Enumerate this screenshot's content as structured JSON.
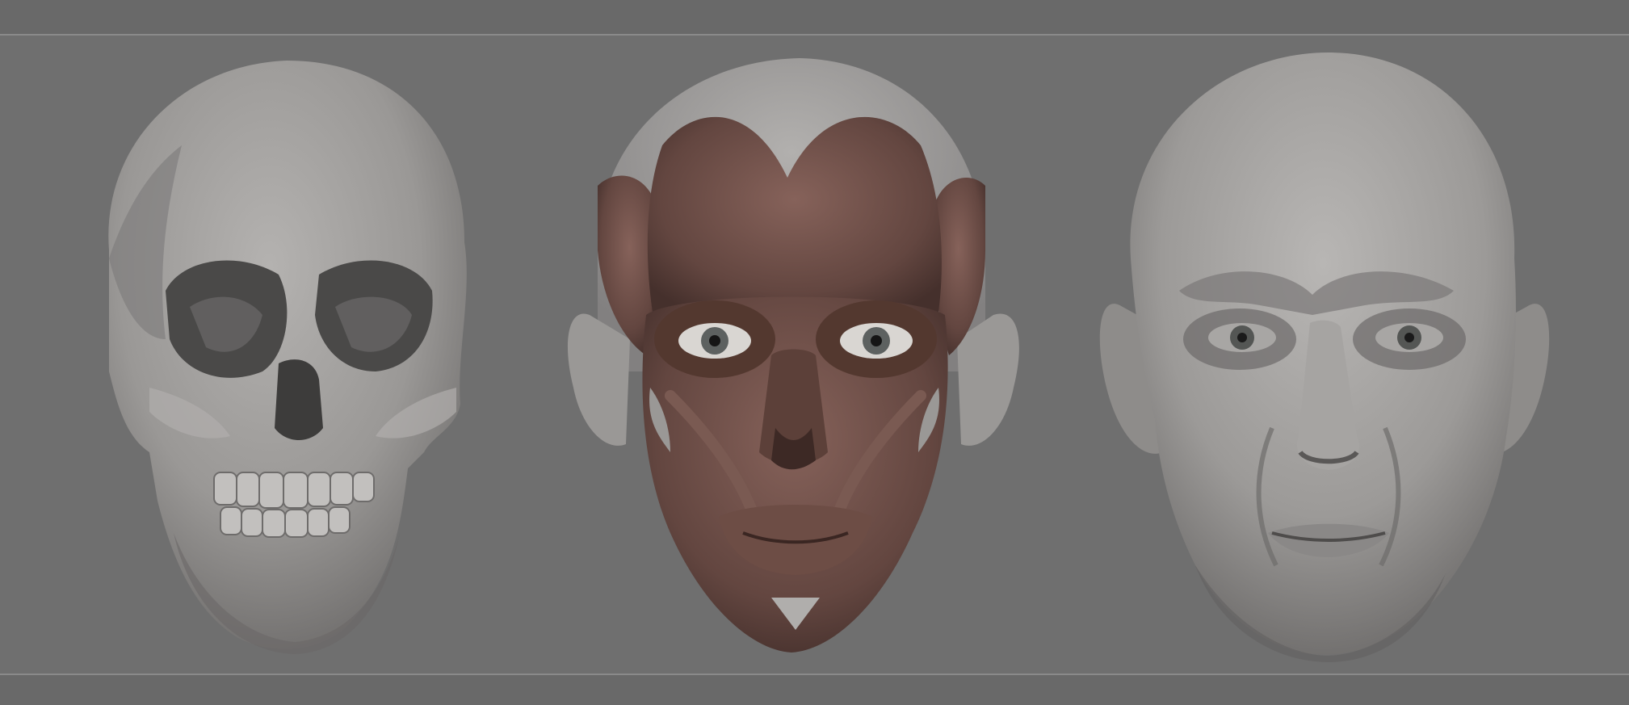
{
  "scene": {
    "background_color": "#6f6f6f",
    "band_color": "#696969",
    "rule_color": "#8a8a8a"
  },
  "models": [
    {
      "id": "skull",
      "name": "skull",
      "material_color": "#9a9896"
    },
    {
      "id": "muscles",
      "name": "facial-muscles",
      "material_color": "#6a4a42",
      "bone_color": "#9a9896"
    },
    {
      "id": "face",
      "name": "head-skin",
      "material_color": "#9c9a98"
    }
  ]
}
